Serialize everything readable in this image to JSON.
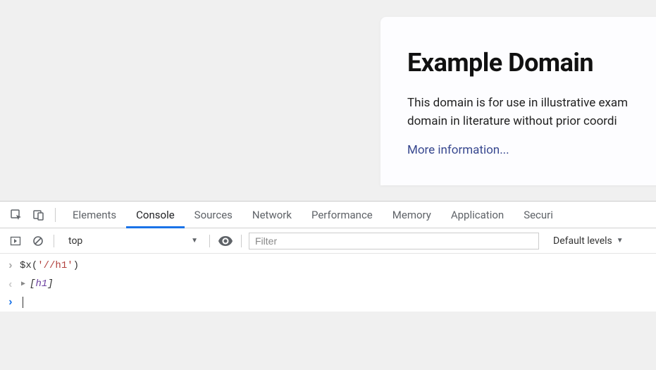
{
  "page": {
    "heading": "Example Domain",
    "paragraph1": "This domain is for use in illustrative exam",
    "paragraph2": "domain in literature without prior coordi",
    "link_text": "More information..."
  },
  "devtools": {
    "tabs": [
      "Elements",
      "Console",
      "Sources",
      "Network",
      "Performance",
      "Memory",
      "Application",
      "Securi"
    ],
    "active_tab": "Console",
    "toolbar": {
      "context": "top",
      "filter_placeholder": "Filter",
      "filter_value": "",
      "levels": "Default levels"
    },
    "console": {
      "input_fn": "$x",
      "input_arg": "'//h1'",
      "output_prefix": "[",
      "output_value": "h1",
      "output_suffix": "]"
    }
  }
}
